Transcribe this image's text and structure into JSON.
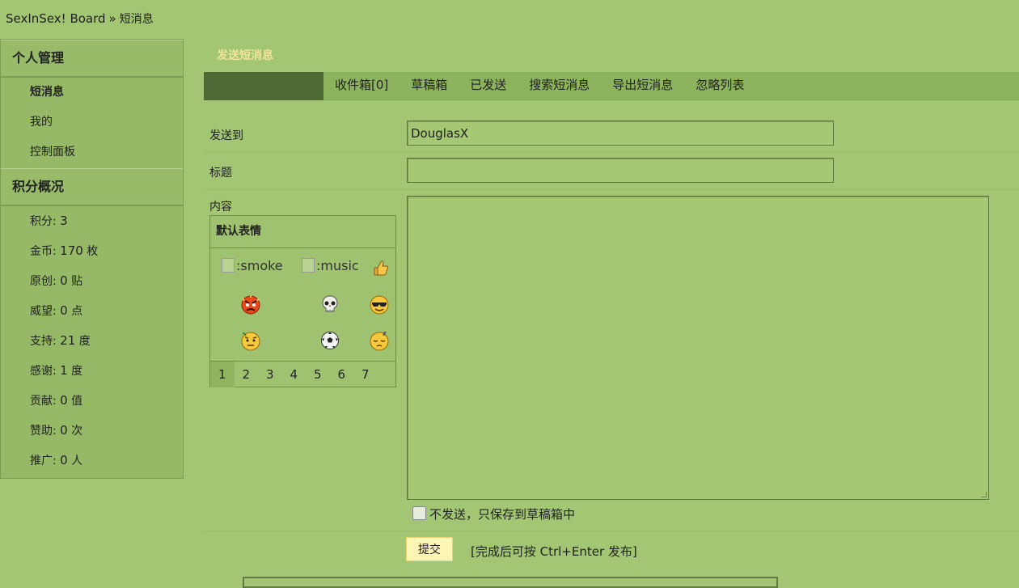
{
  "breadcrumb": {
    "board": "SexInSex! Board",
    "separator": "»",
    "current": "短消息"
  },
  "sidebar": {
    "section1_title": "个人管理",
    "section1_items": [
      "短消息",
      "我的",
      "控制面板"
    ],
    "section2_title": "积分概况",
    "credits": [
      {
        "label": "积分:",
        "value": "3",
        "unit": ""
      },
      {
        "label": "金币:",
        "value": "170",
        "unit": "枚"
      },
      {
        "label": "原创:",
        "value": "0",
        "unit": "贴"
      },
      {
        "label": "威望:",
        "value": "0",
        "unit": "点"
      },
      {
        "label": "支持:",
        "value": "21",
        "unit": "度"
      },
      {
        "label": "感谢:",
        "value": "1",
        "unit": "度"
      },
      {
        "label": "贡献:",
        "value": "0",
        "unit": "值"
      },
      {
        "label": "赞助:",
        "value": "0",
        "unit": "次"
      },
      {
        "label": "推广:",
        "value": "0",
        "unit": "人"
      }
    ]
  },
  "page": {
    "title": "发送短消息"
  },
  "tabs": [
    "收件箱[0]",
    "草稿箱",
    "已发送",
    "搜索短消息",
    "导出短消息",
    "忽略列表"
  ],
  "form": {
    "to_label": "发送到",
    "to_value": "DouglasX",
    "subject_label": "标题",
    "subject_value": "",
    "content_label": "内容",
    "draft_label": "不发送，只保存到草稿箱中",
    "submit_label": "提交",
    "hint": "[完成后可按 Ctrl+Enter 发布]"
  },
  "smilies": {
    "title": "默认表情",
    "broken": [
      ":smoke",
      ":music"
    ],
    "pages": [
      "1",
      "2",
      "3",
      "4",
      "5",
      "6",
      "7"
    ]
  },
  "colors": {
    "background": "#a2c673",
    "sidebar": "#95b966",
    "tab_active": "#4d6a35",
    "title": "#f1e39a",
    "submit": "#fff6b6"
  }
}
